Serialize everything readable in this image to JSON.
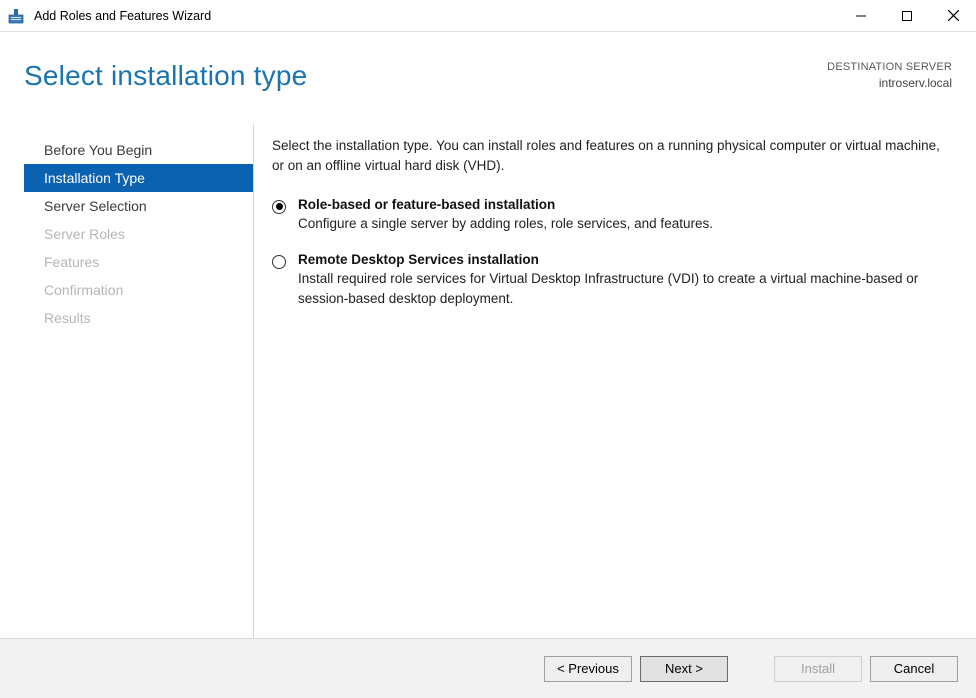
{
  "window": {
    "title": "Add Roles and Features Wizard"
  },
  "header": {
    "title": "Select installation type",
    "destination_label": "DESTINATION SERVER",
    "destination_value": "introserv.local"
  },
  "sidebar": {
    "steps": [
      {
        "label": "Before You Begin",
        "state": "link"
      },
      {
        "label": "Installation Type",
        "state": "active"
      },
      {
        "label": "Server Selection",
        "state": "link"
      },
      {
        "label": "Server Roles",
        "state": "disabled"
      },
      {
        "label": "Features",
        "state": "disabled"
      },
      {
        "label": "Confirmation",
        "state": "disabled"
      },
      {
        "label": "Results",
        "state": "disabled"
      }
    ]
  },
  "content": {
    "intro": "Select the installation type. You can install roles and features on a running physical computer or virtual machine, or on an offline virtual hard disk (VHD).",
    "options": [
      {
        "title": "Role-based or feature-based installation",
        "description": "Configure a single server by adding roles, role services, and features.",
        "selected": true
      },
      {
        "title": "Remote Desktop Services installation",
        "description": "Install required role services for Virtual Desktop Infrastructure (VDI) to create a virtual machine-based or session-based desktop deployment.",
        "selected": false
      }
    ]
  },
  "footer": {
    "previous": "< Previous",
    "next": "Next >",
    "install": "Install",
    "cancel": "Cancel"
  }
}
